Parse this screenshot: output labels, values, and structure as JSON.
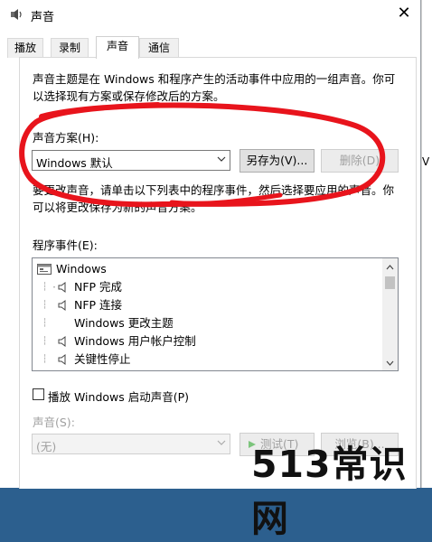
{
  "window": {
    "title": "声音",
    "close_glyph": "✕"
  },
  "tabs": [
    {
      "label": "播放"
    },
    {
      "label": "录制"
    },
    {
      "label": "声音"
    },
    {
      "label": "通信"
    }
  ],
  "description": "声音主题是在 Windows 和程序产生的活动事件中应用的一组声音。你可以选择现有方案或保存修改后的方案。",
  "scheme": {
    "label": "声音方案(H):",
    "selected": "Windows 默认",
    "save_as_label": "另存为(V)...",
    "delete_label": "删除(D)"
  },
  "instructions": "要更改声音，请单击以下列表中的程序事件，然后选择要应用的声音。你可以将更改保存为新的声音方案。",
  "program_events": {
    "label": "程序事件(E):",
    "items": [
      {
        "text": "Windows",
        "level": 0,
        "icon": "window-icon"
      },
      {
        "text": "NFP 完成",
        "level": 1,
        "icon": "speaker-icon"
      },
      {
        "text": "NFP 连接",
        "level": 1,
        "icon": "speaker-icon"
      },
      {
        "text": "Windows 更改主题",
        "level": 1,
        "icon": ""
      },
      {
        "text": "Windows 用户帐户控制",
        "level": 1,
        "icon": "speaker-icon"
      },
      {
        "text": "关键性停止",
        "level": 1,
        "icon": "speaker-icon"
      }
    ]
  },
  "startup_sound": {
    "label": "播放 Windows 启动声音(P)",
    "checked": false
  },
  "sounds": {
    "label": "声音(S):",
    "selected": "(无)",
    "test_label": "测试(T)",
    "browse_label": "浏览(B)..."
  },
  "watermark": "513常识网",
  "right_fragment": "V",
  "colors": {
    "annotation": "#e8141c",
    "desktop": "#2c5f8e"
  }
}
